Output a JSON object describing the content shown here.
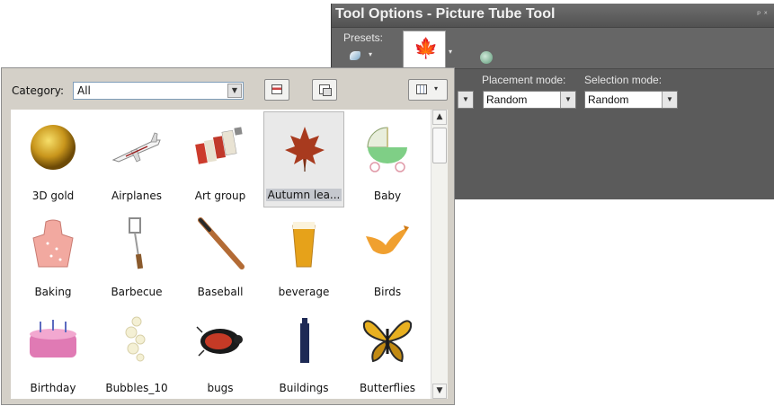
{
  "tool_options": {
    "title": "Tool Options - Picture Tube Tool",
    "pin_glyph": "ᵖ ˣ",
    "presets_label": "Presets:",
    "placement_label": "Placement mode:",
    "placement_value": "Random",
    "selection_label": "Selection mode:",
    "selection_value": "Random"
  },
  "picker": {
    "category_label": "Category:",
    "category_value": "All",
    "items": [
      {
        "label": "3D gold",
        "icon": "gold-sphere-icon"
      },
      {
        "label": "Airplanes",
        "icon": "airplane-icon"
      },
      {
        "label": "Art group",
        "icon": "paint-tubes-icon"
      },
      {
        "label": "Autumn lea...",
        "icon": "maple-leaf-icon",
        "selected": true
      },
      {
        "label": "Baby",
        "icon": "baby-carriage-icon"
      },
      {
        "label": "Baking",
        "icon": "apron-icon"
      },
      {
        "label": "Barbecue",
        "icon": "spatula-icon"
      },
      {
        "label": "Baseball",
        "icon": "baseball-bat-icon"
      },
      {
        "label": "beverage",
        "icon": "beer-glass-icon"
      },
      {
        "label": "Birds",
        "icon": "bird-icon"
      },
      {
        "label": "Birthday",
        "icon": "birthday-cake-icon"
      },
      {
        "label": "Bubbles_10",
        "icon": "bubbles-icon"
      },
      {
        "label": "bugs",
        "icon": "beetle-icon"
      },
      {
        "label": "Buildings",
        "icon": "building-icon"
      },
      {
        "label": "Butterflies",
        "icon": "butterfly-icon"
      }
    ]
  }
}
